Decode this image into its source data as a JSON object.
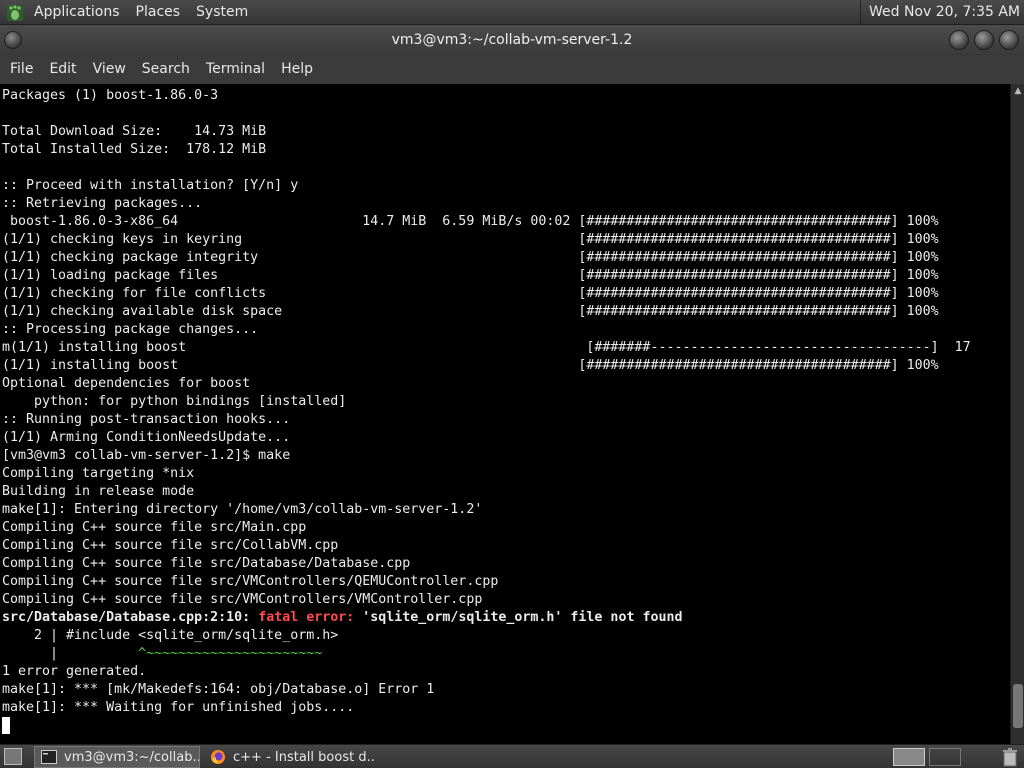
{
  "top_panel": {
    "menus": [
      "Applications",
      "Places",
      "System"
    ],
    "clock": "Wed Nov 20,  7:35 AM"
  },
  "window": {
    "title": "vm3@vm3:~/collab-vm-server-1.2"
  },
  "menubar": [
    "File",
    "Edit",
    "View",
    "Search",
    "Terminal",
    "Help"
  ],
  "terminal": {
    "lines": [
      "Packages (1) boost-1.86.0-3",
      "",
      "Total Download Size:    14.73 MiB",
      "Total Installed Size:  178.12 MiB",
      "",
      ":: Proceed with installation? [Y/n] y",
      ":: Retrieving packages...",
      " boost-1.86.0-3-x86_64                       14.7 MiB  6.59 MiB/s 00:02 [######################################] 100%",
      "(1/1) checking keys in keyring                                          [######################################] 100%",
      "(1/1) checking package integrity                                        [######################################] 100%",
      "(1/1) loading package files                                             [######################################] 100%",
      "(1/1) checking for file conflicts                                       [######################################] 100%",
      "(1/1) checking available disk space                                     [######################################] 100%",
      ":: Processing package changes...",
      "m(1/1) installing boost                                                  [#######-----------------------------------]  17",
      "(1/1) installing boost                                                  [######################################] 100%",
      "Optional dependencies for boost",
      "    python: for python bindings [installed]",
      ":: Running post-transaction hooks...",
      "(1/1) Arming ConditionNeedsUpdate...",
      "[vm3@vm3 collab-vm-server-1.2]$ make",
      "Compiling targeting *nix",
      "Building in release mode",
      "make[1]: Entering directory '/home/vm3/collab-vm-server-1.2'",
      "Compiling C++ source file src/Main.cpp",
      "Compiling C++ source file src/CollabVM.cpp",
      "Compiling C++ source file src/Database/Database.cpp",
      "Compiling C++ source file src/VMControllers/QEMUController.cpp",
      "Compiling C++ source file src/VMControllers/VMController.cpp"
    ],
    "error_line": {
      "location": "src/Database/Database.cpp:2:10: ",
      "label": "fatal error: ",
      "message": "'sqlite_orm/sqlite_orm.h' file not found"
    },
    "source_line": "    2 | #include <sqlite_orm/sqlite_orm.h>",
    "marker_prefix": "      |          ",
    "marker": "^~~~~~~~~~~~~~~~~~~~~~~",
    "tail_lines": [
      "1 error generated.",
      "make[1]: *** [mk/Makedefs:164: obj/Database.o] Error 1",
      "make[1]: *** Waiting for unfinished jobs...."
    ]
  },
  "taskbar": {
    "tasks": [
      {
        "label": "vm3@vm3:~/collab..."
      },
      {
        "label": "c++ - Install boost d..."
      }
    ]
  },
  "colors": {
    "error": "#ff4b4b",
    "marker": "#55d24a",
    "terminal_bg": "#000000"
  }
}
